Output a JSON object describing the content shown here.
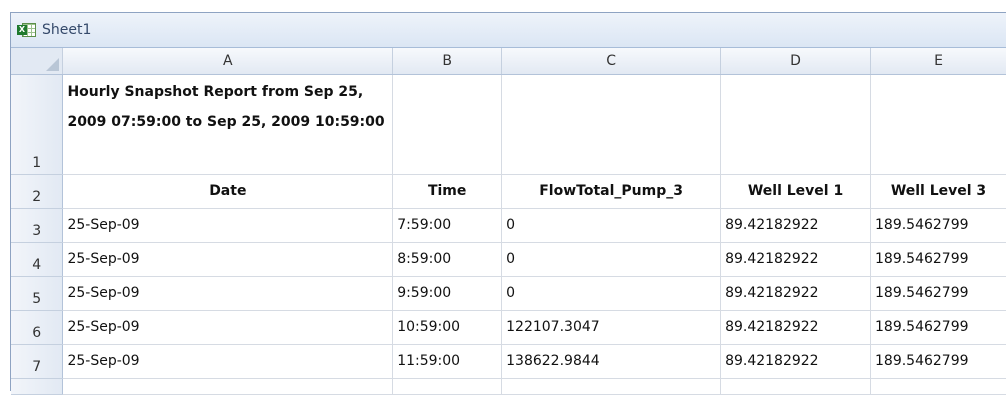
{
  "window": {
    "title": "Sheet1",
    "icon": "excel-sheet-icon"
  },
  "columns": [
    "A",
    "B",
    "C",
    "D",
    "E"
  ],
  "title_row": {
    "row_number": "1",
    "text": "Hourly Snapshot Report from Sep 25, 2009 07:59:00 to Sep 25, 2009 10:59:00"
  },
  "header_row": {
    "row_number": "2",
    "date": "Date",
    "time": "Time",
    "flow": "FlowTotal_Pump_3",
    "well1": "Well Level 1",
    "well3": "Well Level 3"
  },
  "rows": [
    {
      "num": "3",
      "date": "25-Sep-09",
      "time": "7:59:00",
      "flow": "0",
      "well1": "89.42182922",
      "well3": "189.5462799"
    },
    {
      "num": "4",
      "date": "25-Sep-09",
      "time": "8:59:00",
      "flow": "0",
      "well1": "89.42182922",
      "well3": "189.5462799"
    },
    {
      "num": "5",
      "date": "25-Sep-09",
      "time": "9:59:00",
      "flow": "0",
      "well1": "89.42182922",
      "well3": "189.5462799"
    },
    {
      "num": "6",
      "date": "25-Sep-09",
      "time": "10:59:00",
      "flow": "122107.3047",
      "well1": "89.42182922",
      "well3": "189.5462799"
    },
    {
      "num": "7",
      "date": "25-Sep-09",
      "time": "11:59:00",
      "flow": "138622.9844",
      "well1": "89.42182922",
      "well3": "189.5462799"
    }
  ]
}
